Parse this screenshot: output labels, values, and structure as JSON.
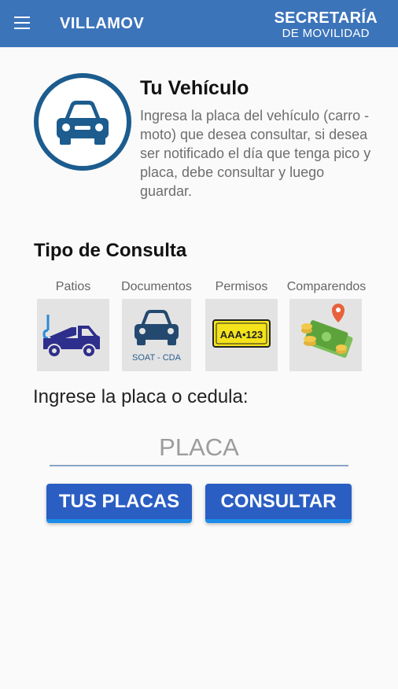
{
  "appbar": {
    "title": "VILLAMOV",
    "brand_line1": "SECRETARÍA",
    "brand_line2": "DE MOVILIDAD",
    "menu_icon": "hamburger-menu-icon"
  },
  "hero": {
    "icon": "car-circle-icon",
    "title": "Tu Vehículo",
    "description": "Ingresa la placa del vehículo (carro - moto) que desea consultar, si desea ser notificado el día que tenga pico y placa, debe consultar y luego guardar."
  },
  "consulta": {
    "title": "Tipo de Consulta",
    "types": [
      {
        "label": "Patios",
        "icon": "tow-truck-icon"
      },
      {
        "label": "Documentos",
        "icon": "car-documents-icon",
        "caption": "SOAT - CDA"
      },
      {
        "label": "Permisos",
        "icon": "license-plate-icon",
        "plate": "AAA•123"
      },
      {
        "label": "Comparendos",
        "icon": "money-fine-icon"
      }
    ]
  },
  "form": {
    "prompt": "Ingrese la placa o cedula:",
    "placeholder": "PLACA",
    "value": ""
  },
  "buttons": {
    "tus_placas": "TUS PLACAS",
    "consultar": "CONSULTAR"
  },
  "colors": {
    "appbar": "#3c74ba",
    "primary_dark": "#1c5c8e",
    "button": "#2a5ec3",
    "button_accent": "#1a8be8"
  }
}
